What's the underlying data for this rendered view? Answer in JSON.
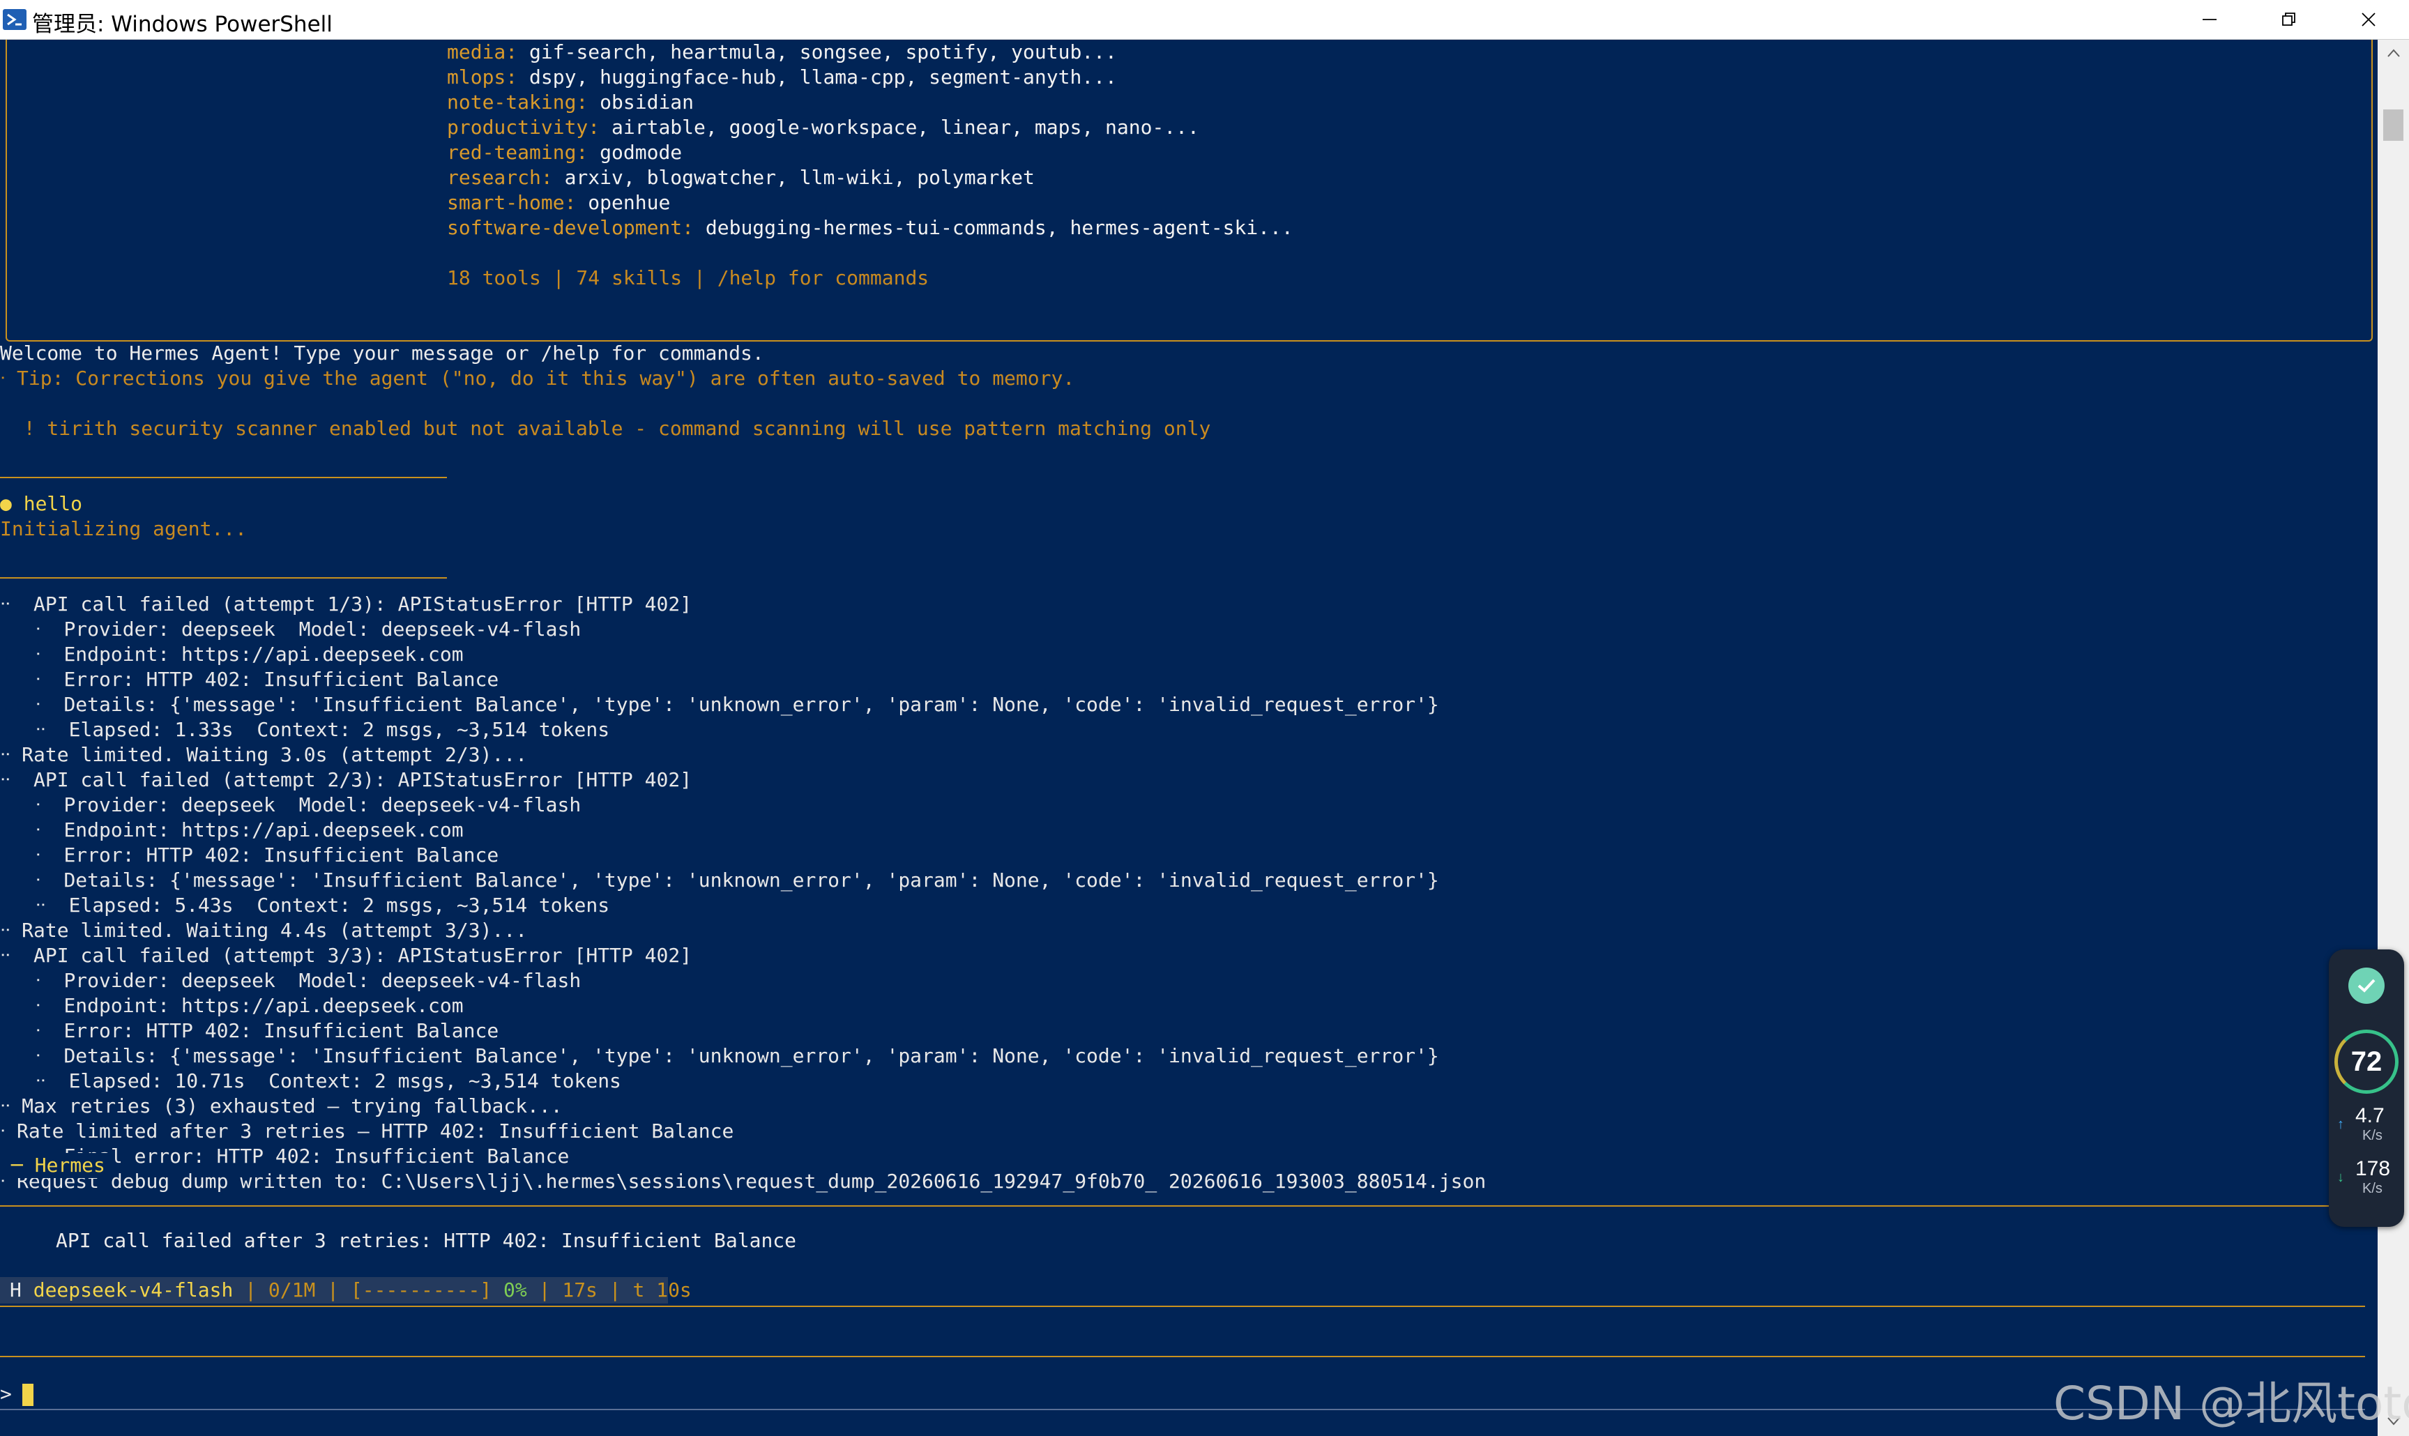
{
  "window": {
    "title": "管理员: Windows PowerShell",
    "minimize_icon": "minimize-icon",
    "restore_icon": "restore-icon",
    "close_icon": "close-icon"
  },
  "banner": {
    "skills": [
      {
        "category": "media:",
        "items": "gif-search, heartmula, songsee, spotify, youtub..."
      },
      {
        "category": "mlops:",
        "items": "dspy, huggingface-hub, llama-cpp, segment-anyth..."
      },
      {
        "category": "note-taking:",
        "items": "obsidian"
      },
      {
        "category": "productivity:",
        "items": "airtable, google-workspace, linear, maps, nano-..."
      },
      {
        "category": "red-teaming:",
        "items": "godmode"
      },
      {
        "category": "research:",
        "items": "arxiv, blogwatcher, llm-wiki, polymarket"
      },
      {
        "category": "smart-home:",
        "items": "openhue"
      },
      {
        "category": "software-development:",
        "items": "debugging-hermes-tui-commands, hermes-agent-ski..."
      }
    ],
    "summary": "18 tools | 74 skills | /help for commands"
  },
  "welcome": "Welcome to Hermes Agent! Type your message or /help for commands.",
  "tip": "ᐧ Tip: Corrections you give the agent (\"no, do it this way\") are often auto-saved to memory.",
  "warning": "  ! tirith security scanner enabled but not available - command scanning will use pattern matching only",
  "user_message": "● hello",
  "initializing": "Initializing agent...",
  "log": [
    "ᐧᐧ  API call failed (attempt 1/3): APIStatusError [HTTP 402]",
    "   ᐧ  Provider: deepseek  Model: deepseek-v4-flash",
    "   ᐧ  Endpoint: https://api.deepseek.com",
    "   ᐧ  Error: HTTP 402: Insufficient Balance",
    "   ᐧ  Details: {'message': 'Insufficient Balance', 'type': 'unknown_error', 'param': None, 'code': 'invalid_request_error'}",
    "   ᐧᐧ  Elapsed: 1.33s  Context: 2 msgs, ~3,514 tokens",
    "ᐧᐧ Rate limited. Waiting 3.0s (attempt 2/3)...",
    "ᐧᐧ  API call failed (attempt 2/3): APIStatusError [HTTP 402]",
    "   ᐧ  Provider: deepseek  Model: deepseek-v4-flash",
    "   ᐧ  Endpoint: https://api.deepseek.com",
    "   ᐧ  Error: HTTP 402: Insufficient Balance",
    "   ᐧ  Details: {'message': 'Insufficient Balance', 'type': 'unknown_error', 'param': None, 'code': 'invalid_request_error'}",
    "   ᐧᐧ  Elapsed: 5.43s  Context: 2 msgs, ~3,514 tokens",
    "ᐧᐧ Rate limited. Waiting 4.4s (attempt 3/3)...",
    "ᐧᐧ  API call failed (attempt 3/3): APIStatusError [HTTP 402]",
    "   ᐧ  Provider: deepseek  Model: deepseek-v4-flash",
    "   ᐧ  Endpoint: https://api.deepseek.com",
    "   ᐧ  Error: HTTP 402: Insufficient Balance",
    "   ᐧ  Details: {'message': 'Insufficient Balance', 'type': 'unknown_error', 'param': None, 'code': 'invalid_request_error'}",
    "   ᐧᐧ  Elapsed: 10.71s  Context: 2 msgs, ~3,514 tokens",
    "ᐧᐧ Max retries (3) exhausted — trying fallback...",
    "ᐧ Rate limited after 3 retries — HTTP 402: Insufficient Balance",
    "   ᐧ  Final error: HTTP 402: Insufficient Balance",
    "ᐧ Request debug dump written to: C:\\Users\\ljj\\.hermes\\sessions\\request_dump_20260616_192947_9f0b70_ 20260616_193003_880514.json"
  ],
  "hermes_label": "─ Hermes",
  "hermes_response": "API call failed after 3 retries: HTTP 402: Insufficient Balance",
  "status": {
    "prefix": "H",
    "model": "deepseek-v4-flash",
    "sep1": " | ",
    "tokens": "0/1M",
    "sep2": " | ",
    "bar": "[----------]",
    "percent": " 0%",
    "sep3": " | ",
    "elapsed": "17s",
    "sep4": " | ",
    "turn": "t 10s"
  },
  "prompt_symbol": ">",
  "net_widget": {
    "score": "72",
    "upload_value": "4.7",
    "upload_unit": "K/s",
    "download_value": "178",
    "download_unit": "K/s"
  },
  "watermark": "CSDN @北风toto",
  "colors": {
    "background": "#012456",
    "accent": "#c9911e",
    "highlight": "#f2d44a"
  }
}
